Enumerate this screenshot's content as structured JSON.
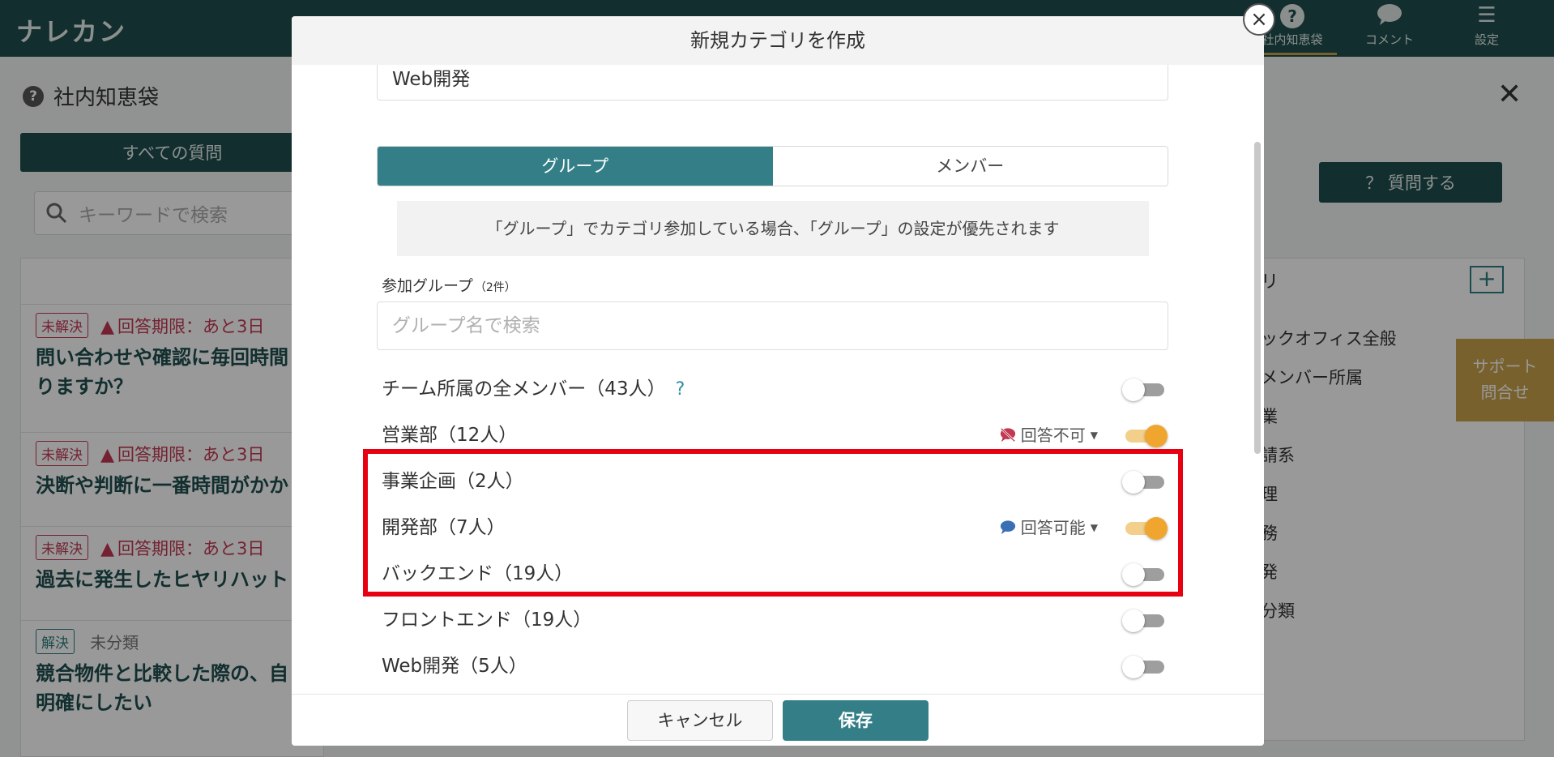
{
  "app": {
    "logo": "ナレカン",
    "nav": [
      {
        "label": "社内知恵袋",
        "icon": "question-circle-icon"
      },
      {
        "label": "コメント",
        "icon": "comment-icon"
      },
      {
        "label": "設定",
        "icon": "menu-icon"
      }
    ]
  },
  "left_pane": {
    "title": "社内知恵袋",
    "all_questions_label": "すべての質問",
    "search_placeholder": "キーワードで検索",
    "questions": [
      {
        "status": "未解決",
        "deadline": "回答期限：あと3日",
        "text": "問い合わせや確認に毎回時間\nりますか？"
      },
      {
        "status": "未解決",
        "deadline": "回答期限：あと3日",
        "text": "決断や判断に一番時間がかか"
      },
      {
        "status": "未解決",
        "deadline": "回答期限：あと3日",
        "text": "過去に発生したヒヤリハット"
      },
      {
        "status": "解決",
        "category": "未分類",
        "text": "競合物件と比較した際の、自\n明確にしたい"
      }
    ]
  },
  "right_pane": {
    "ask_button": "？ 質問する",
    "category_header": "リ",
    "categories": [
      "ックオフィス全般",
      "メンバー所属",
      "業",
      "請系",
      "理",
      "務",
      "発",
      "分類"
    ],
    "support_label": "サポート\n問合せ"
  },
  "modal": {
    "title": "新規カテゴリを作成",
    "category_name_value": "Web開発",
    "tabs": [
      {
        "label": "グループ",
        "active": true
      },
      {
        "label": "メンバー",
        "active": false
      }
    ],
    "notice": "「グループ」でカテゴリ参加している場合、「グループ」の設定が優先されます",
    "group_label": "参加グループ",
    "group_count": "（2件）",
    "group_search_placeholder": "グループ名で検索",
    "all_members_help": "?",
    "groups": [
      {
        "name": "チーム所属の全メンバー（43人）",
        "enabled": false,
        "permission": null
      },
      {
        "name": "営業部（12人）",
        "enabled": true,
        "permission": "回答不可"
      },
      {
        "name": "事業企画（2人）",
        "enabled": false,
        "permission": null
      },
      {
        "name": "開発部（7人）",
        "enabled": true,
        "permission": "回答可能"
      },
      {
        "name": "バックエンド（19人）",
        "enabled": false,
        "permission": null
      },
      {
        "name": "フロントエンド（19人）",
        "enabled": false,
        "permission": null
      },
      {
        "name": "Web開発（5人）",
        "enabled": false,
        "permission": null
      }
    ],
    "cancel_label": "キャンセル",
    "save_label": "保存",
    "close_label": "×"
  },
  "colors": {
    "primary": "#347f87",
    "header_dark": "#1f4e4e",
    "toggle_on": "#f0a62e",
    "highlight": "#e60012",
    "unresolved": "#c23852",
    "no_answer_icon": "#c23852",
    "answer_icon": "#3a6fb5"
  }
}
